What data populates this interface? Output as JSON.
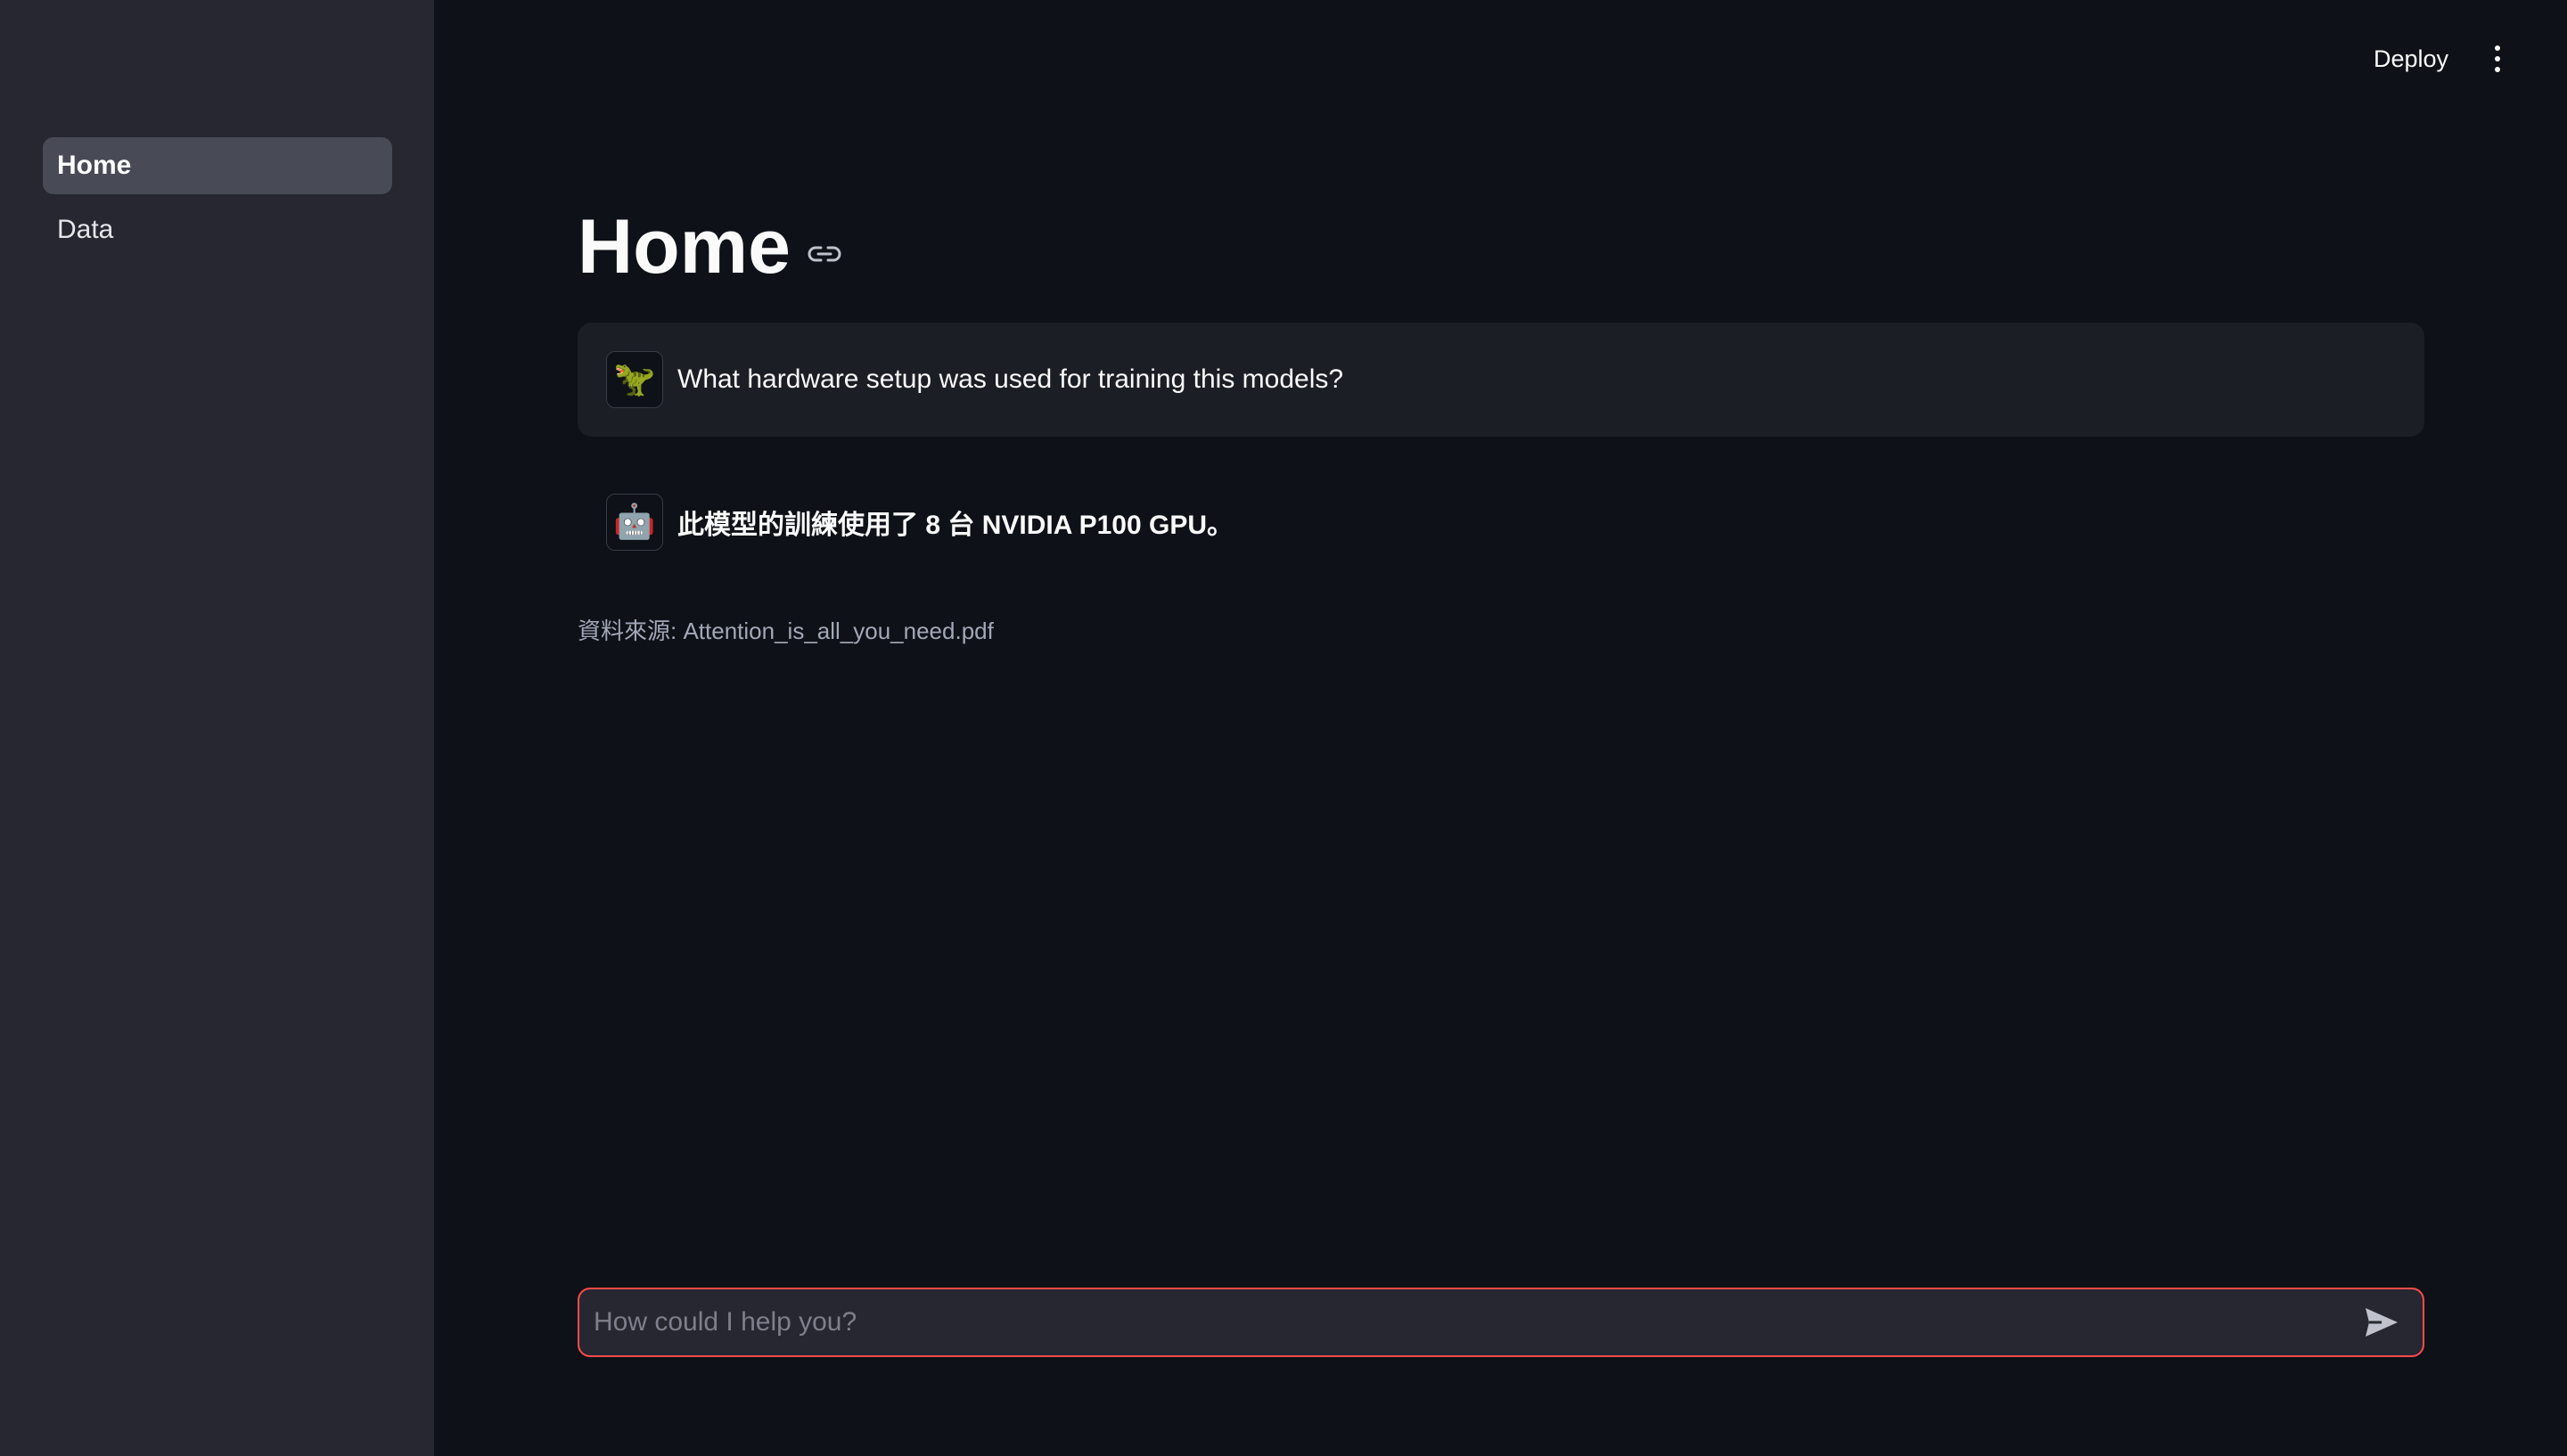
{
  "sidebar": {
    "items": [
      {
        "label": "Home",
        "active": true
      },
      {
        "label": "Data",
        "active": false
      }
    ]
  },
  "header": {
    "deploy_label": "Deploy",
    "menu_icon": "more-vertical-icon"
  },
  "main": {
    "title": "Home",
    "title_link_icon": "link-icon",
    "messages": [
      {
        "role": "user",
        "avatar": "🦖",
        "text": "What hardware setup was used for training this models?"
      },
      {
        "role": "assistant",
        "avatar": "🤖",
        "text": "此模型的訓練使用了 8 台 NVIDIA P100 GPU。"
      }
    ],
    "source": "資料來源: Attention_is_all_you_need.pdf"
  },
  "chat_input": {
    "placeholder": "How could I help you?",
    "value": "",
    "send_icon": "send-icon"
  },
  "colors": {
    "background": "#0e1117",
    "sidebar": "#262730",
    "accent": "#ff4b4b",
    "user_message_bg": "#1c1e26"
  }
}
